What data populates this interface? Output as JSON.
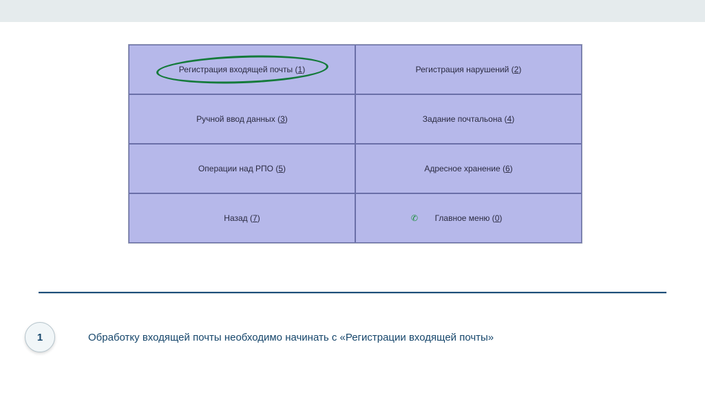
{
  "menu": {
    "rows": [
      [
        {
          "label": "Регистрация входящей почты",
          "hotkey": "1",
          "highlighted": true
        },
        {
          "label": "Регистрация нарушений",
          "hotkey": "2"
        }
      ],
      [
        {
          "label": "Ручной ввод данных",
          "hotkey": "3"
        },
        {
          "label": "Задание почтальона",
          "hotkey": "4"
        }
      ],
      [
        {
          "label": "Операции над РПО",
          "hotkey": "5"
        },
        {
          "label": "Адресное хранение",
          "hotkey": "6"
        }
      ],
      [
        {
          "label": "Назад",
          "hotkey": "7"
        },
        {
          "label": "Главное меню",
          "hotkey": "0",
          "icon": "phone"
        }
      ]
    ]
  },
  "step": {
    "number": "1",
    "text": "Обработку входящей почты необходимо начинать с «Регистрации входящей почты»"
  }
}
